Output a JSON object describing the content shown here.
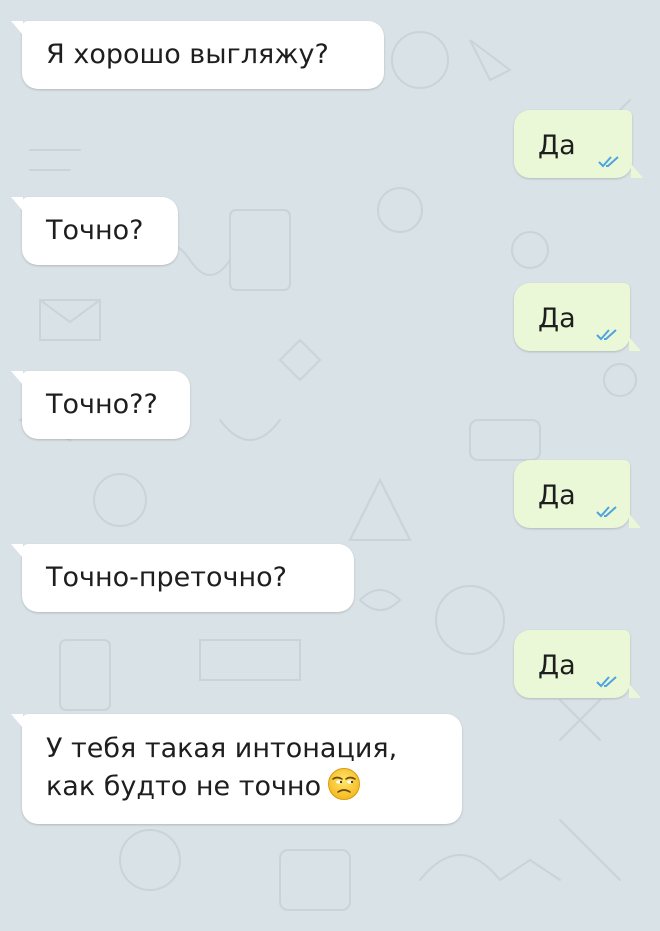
{
  "chat": {
    "messages": [
      {
        "direction": "incoming",
        "text": "Я хорошо выгляжу?"
      },
      {
        "direction": "outgoing",
        "text": "Да",
        "status": "read-double-check-icon"
      },
      {
        "direction": "incoming",
        "text": "Точно?"
      },
      {
        "direction": "outgoing",
        "text": "Да",
        "status": "read-double-check-icon"
      },
      {
        "direction": "incoming",
        "text": "Точно??"
      },
      {
        "direction": "outgoing",
        "text": "Да",
        "status": "read-double-check-icon"
      },
      {
        "direction": "incoming",
        "text": "Точно-преточно?"
      },
      {
        "direction": "outgoing",
        "text": "Да",
        "status": "read-double-check-icon"
      },
      {
        "direction": "incoming",
        "text_line1": "У тебя такая интонация,",
        "text_line2": "как будто не точно",
        "emoji": "unamused-face-emoji"
      }
    ]
  },
  "colors": {
    "background": "#d9e2e6",
    "incoming_bubble": "#ffffff",
    "outgoing_bubble": "#eaf8d7",
    "read_check": "#4fa3df"
  }
}
